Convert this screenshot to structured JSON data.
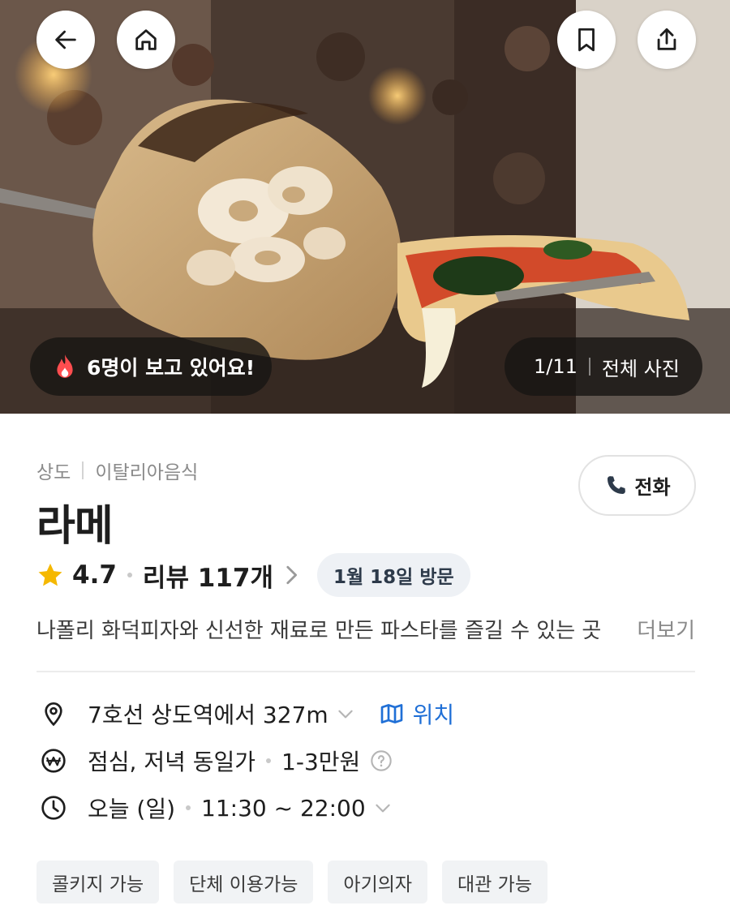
{
  "hero": {
    "viewers_text": "6명이 보고 있어요!",
    "photo_index": "1/11",
    "all_photos_label": "전체 사진"
  },
  "toolbar": {
    "back_icon": "arrow-left-icon",
    "home_icon": "home-icon",
    "bookmark_icon": "bookmark-icon",
    "share_icon": "share-icon"
  },
  "place": {
    "area": "상도",
    "category": "이탈리아음식",
    "name": "라메",
    "rating": "4.7",
    "reviews_label": "리뷰 117개",
    "visit_badge": "1월 18일 방문",
    "description": "나폴리 화덕피자와 신선한 재료로 만든 파스타를 즐길 수 있는 곳",
    "more_label": "더보기",
    "call_label": "전화"
  },
  "info": {
    "distance": "7호선 상도역에서 327m",
    "location_link": "위치",
    "meal_times": "점심, 저녁 동일가",
    "price": "1-3만원",
    "today": "오늘 (일)",
    "hours": "11:30 ~ 22:00"
  },
  "tags": [
    "콜키지 가능",
    "단체 이용가능",
    "아기의자",
    "대관 가능"
  ],
  "colors": {
    "accent_blue": "#1f6fd6",
    "star_yellow": "#f5b800",
    "fire_red": "#ff4d4f"
  }
}
